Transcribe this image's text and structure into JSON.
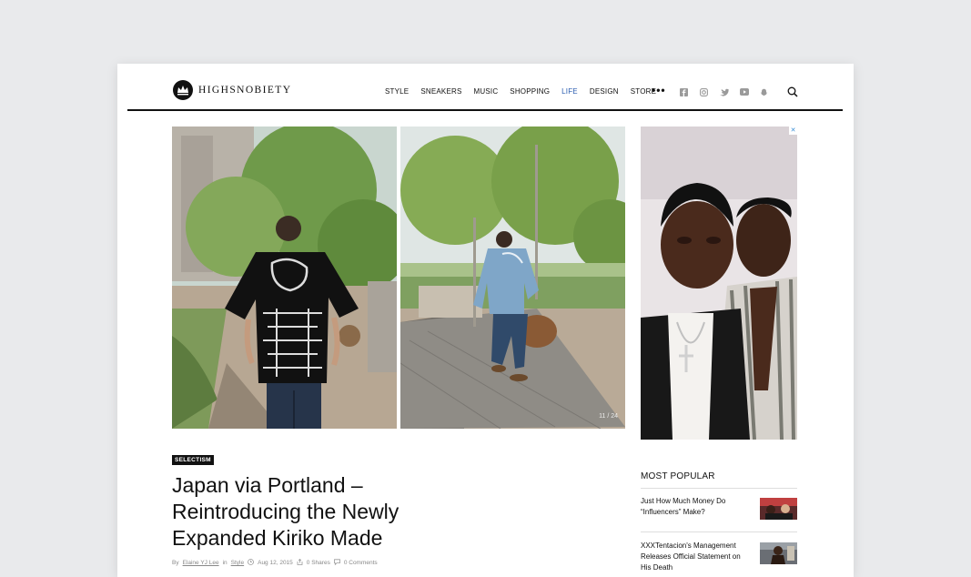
{
  "brand": {
    "name": "HIGHSNOBIETY",
    "logo_icon": "crown-icon"
  },
  "nav": {
    "items": [
      {
        "label": "STYLE",
        "active": false
      },
      {
        "label": "SNEAKERS",
        "active": false
      },
      {
        "label": "MUSIC",
        "active": false
      },
      {
        "label": "SHOPPING",
        "active": false
      },
      {
        "label": "LIFE",
        "active": true
      },
      {
        "label": "DESIGN",
        "active": false
      },
      {
        "label": "STORE",
        "active": false
      }
    ],
    "more_label": "•••",
    "social_icons": [
      "facebook-icon",
      "instagram-icon",
      "twitter-icon",
      "youtube-icon",
      "snapchat-icon"
    ],
    "search_icon": "search-icon"
  },
  "gallery": {
    "counter": "11 / 24"
  },
  "ad": {
    "close_label": "✕"
  },
  "article": {
    "tag": "SELECTISM",
    "headline_lines": [
      "Japan via Portland –",
      "Reintroducing the Newly",
      "Expanded Kiriko Made"
    ],
    "byline": {
      "by": "By",
      "author": "Elaine YJ Lee",
      "in": "in",
      "section": "Style",
      "date": "Aug 12, 2015",
      "shares": "0 Shares",
      "comments": "0 Comments"
    }
  },
  "most_popular": {
    "title": "MOST POPULAR",
    "items": [
      {
        "title": "Just How Much Money Do “Influencers” Make?"
      },
      {
        "title": "XXXTentacion's Management Releases Official Statement on His Death"
      }
    ]
  },
  "colors": {
    "accent": "#2a5db0",
    "background": "#e9eaec"
  }
}
